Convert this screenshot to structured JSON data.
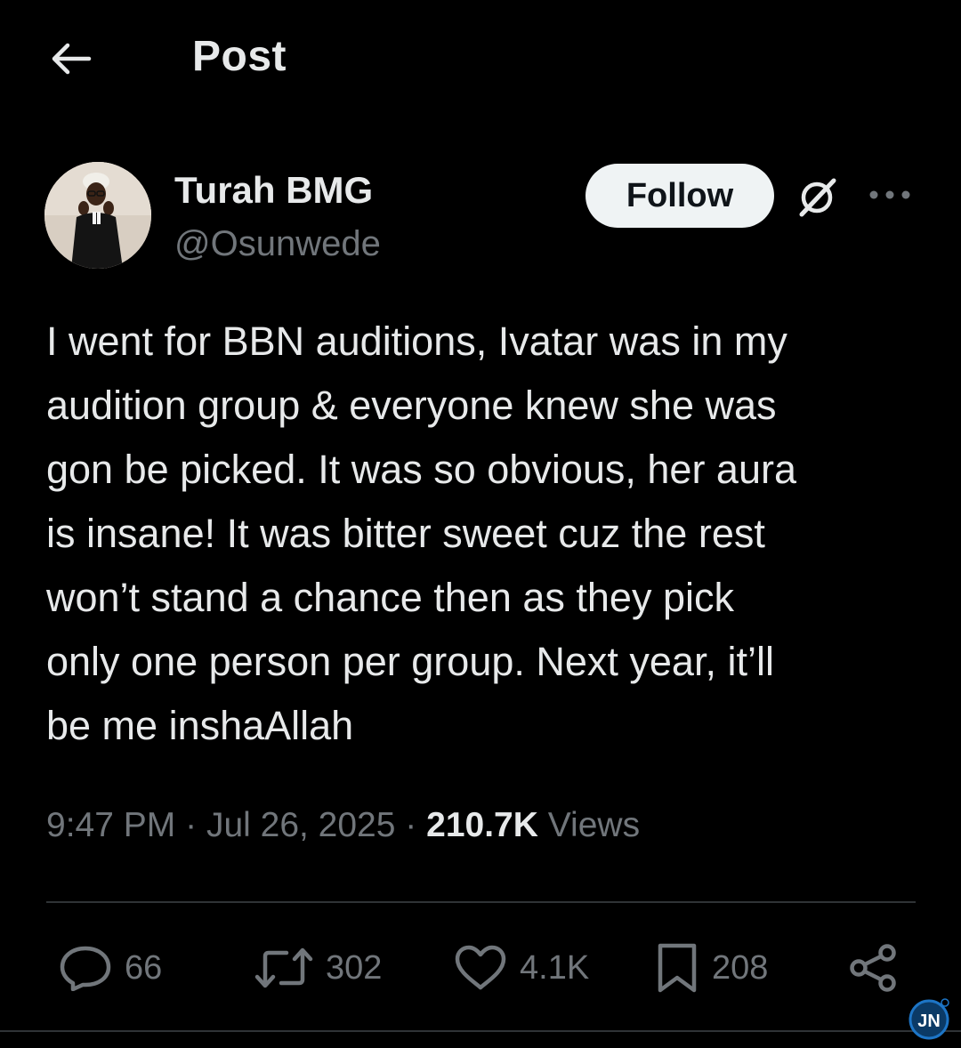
{
  "header": {
    "title": "Post",
    "back_icon": "arrow-left-icon"
  },
  "author": {
    "display_name": "Turah BMG",
    "handle": "@Osunwede",
    "follow_label": "Follow",
    "grok_icon": "grok-icon",
    "more_icon": "more-horizontal-icon"
  },
  "post": {
    "text": "I went for BBN auditions, Ivatar was in my\naudition group & everyone knew she was\ngon be picked. It was so obvious, her aura\nis insane! It was bitter sweet cuz the rest\nwon’t stand a chance then as they pick\nonly one person per group. Next year, it’ll\nbe me inshaAllah",
    "time": "9:47 PM",
    "date": "Jul 26, 2025",
    "separator": "·",
    "views_count": "210.7K",
    "views_label": "Views"
  },
  "actions": {
    "replies": "66",
    "reposts": "302",
    "likes": "4.1K",
    "bookmarks": "208"
  },
  "watermark": {
    "text": "JN"
  },
  "colors": {
    "background": "#000000",
    "text_primary": "#e7e9ea",
    "text_secondary": "#71767b",
    "divider": "#2f3336",
    "follow_bg": "#eff3f4",
    "watermark_blue": "#1d75c6"
  }
}
